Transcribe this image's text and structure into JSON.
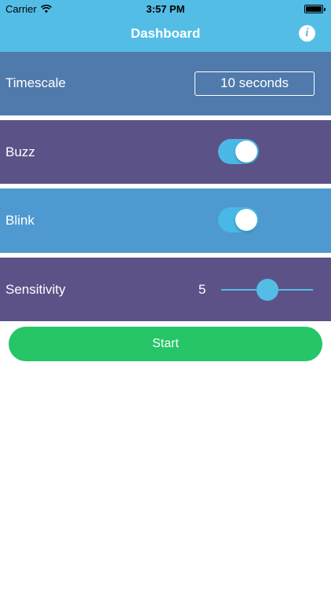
{
  "status_bar": {
    "carrier": "Carrier",
    "time": "3:57 PM",
    "wifi_icon": "wifi-icon",
    "battery_icon": "battery-full-icon"
  },
  "nav": {
    "title": "Dashboard",
    "info_icon_glyph": "i",
    "info_icon": "info-icon"
  },
  "timescale": {
    "label": "Timescale",
    "value": "10 seconds"
  },
  "buzz": {
    "label": "Buzz",
    "enabled": true
  },
  "blink": {
    "label": "Blink",
    "enabled": true
  },
  "sensitivity": {
    "label": "Sensitivity",
    "value": "5",
    "min": 0,
    "max": 10,
    "level": 5
  },
  "start_button": {
    "label": "Start"
  },
  "colors": {
    "header": "#53bde6",
    "timescale_row": "#4f7aab",
    "buzz_row": "#5b5288",
    "blink_row": "#4e9ad0",
    "sensitivity_row": "#5c5288",
    "toggle_on": "#4ab8e6",
    "start_button": "#26c567"
  }
}
